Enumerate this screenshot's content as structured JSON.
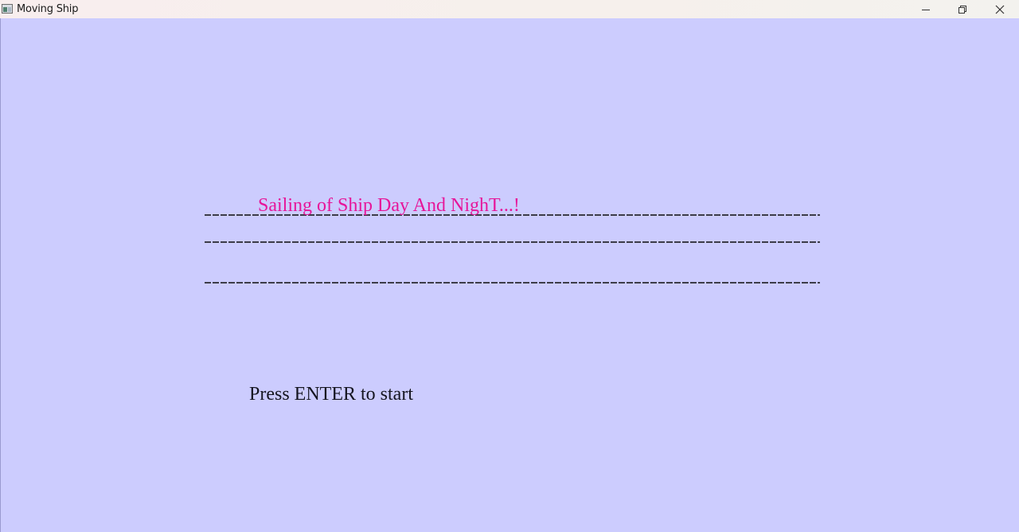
{
  "window": {
    "title": "Moving Ship",
    "icon": "app-window-icon",
    "controls": [
      "minimize-icon",
      "restore-icon",
      "close-icon"
    ]
  },
  "game": {
    "title": "Sailing of Ship Day And NighT...!",
    "prompt": "Press ENTER to start",
    "colors": {
      "background": "#ccccfe",
      "title": "#e6169a",
      "prompt": "#151520",
      "dash_lines": "#3c3c48"
    }
  }
}
